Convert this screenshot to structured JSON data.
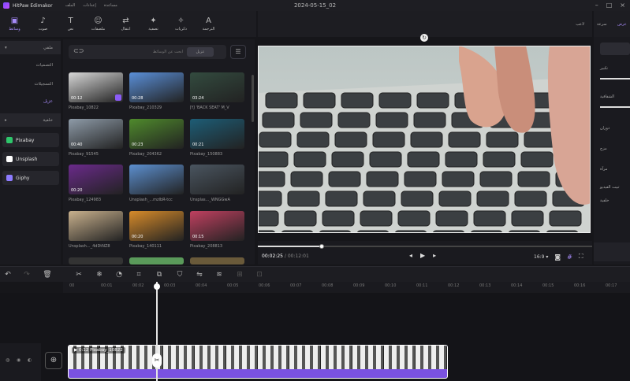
{
  "window": {
    "app_name": "HitPaw Edimakor",
    "project_title": "2024-05-15_02",
    "menu": [
      "الملف",
      "إعدادات",
      "مساعدة"
    ]
  },
  "toolbar": {
    "items": [
      {
        "label": "وسائط",
        "icon": "media-icon",
        "active": true
      },
      {
        "label": "صوت",
        "icon": "music-icon",
        "active": false
      },
      {
        "label": "نص",
        "icon": "text-icon",
        "active": false
      },
      {
        "label": "ملصقات",
        "icon": "sticker-icon",
        "active": false
      },
      {
        "label": "انتقال",
        "icon": "transition-icon",
        "active": false
      },
      {
        "label": "تصفية",
        "icon": "filter-icon",
        "active": false
      },
      {
        "label": "ذكريات",
        "icon": "effects-icon",
        "active": false
      },
      {
        "label": "الترجمة",
        "icon": "ai-subtitle-icon",
        "active": false
      }
    ]
  },
  "sidebar": {
    "rows": [
      {
        "label": "ملفي",
        "chevron": "▾"
      },
      {
        "label": "التصميات",
        "chevron": ""
      },
      {
        "label": "التسجيلات",
        "chevron": ""
      },
      {
        "label": "عزيل",
        "chevron": "",
        "highlight": true
      },
      {
        "label": "خلفية",
        "chevron": "▸"
      }
    ],
    "sources": [
      {
        "label": "Pixabay",
        "color": "#2ec66b"
      },
      {
        "label": "Unsplash",
        "color": "#ffffff"
      },
      {
        "label": "Giphy",
        "color": "#8d7bff"
      }
    ]
  },
  "media": {
    "search_button": "عزيل",
    "search_placeholder": "ابحث عن الوسائط",
    "thumbs": [
      {
        "label": "Pixabay_10822",
        "duration": "00:12",
        "bg": "#d7d7d7",
        "fav": true
      },
      {
        "label": "Pixabay_210329",
        "duration": "00:28",
        "bg": "#5a8fd8"
      },
      {
        "label": "JYJ 'BACK SEAT' M_V",
        "duration": "03:24",
        "bg": "#334b3f"
      },
      {
        "label": "Pixabay_91545",
        "duration": "00:40",
        "bg": "#8e9ba8"
      },
      {
        "label": "Pixabay_204362",
        "duration": "00:23",
        "bg": "#4f8a2c"
      },
      {
        "label": "Pixabay_150883",
        "duration": "00:21",
        "bg": "#1d5d76"
      },
      {
        "label": "Pixabay_124983",
        "duration": "00:20",
        "bg": "#6a2a8a"
      },
      {
        "label": "Unsplash_...mzlbR-tcc",
        "duration": "",
        "bg": "#5c8fcf"
      },
      {
        "label": "Unsplas..._WNGGwA",
        "duration": "",
        "bg": "#4a5560"
      },
      {
        "label": "Unsplash..._4dDtNZ8",
        "duration": "",
        "bg": "#c9b18d"
      },
      {
        "label": "Pixabay_140111",
        "duration": "00:20",
        "bg": "#d78b2a"
      },
      {
        "label": "Pixabay_208813",
        "duration": "00:15",
        "bg": "#c04060"
      }
    ]
  },
  "preview": {
    "header_label": "لاعب",
    "time_current": "00:02:25",
    "time_total": "00:12:01",
    "aspect": "16:9",
    "progress": 0.19
  },
  "right_panel": {
    "tabs": [
      "عرض",
      "سرعة"
    ],
    "labels": [
      "تكبير",
      "الشفافية",
      "دوران",
      "مزج",
      "مرآة",
      "ثبيت الفيديو",
      "خلفية"
    ]
  },
  "timeline": {
    "ticks": [
      "00",
      "00:01",
      "00:02",
      "00:03",
      "00:04",
      "00:05",
      "00:06",
      "00:07",
      "00:08",
      "00:09",
      "00:10",
      "00:11",
      "00:12",
      "00:13",
      "00:14",
      "00:15",
      "00:16",
      "00:17"
    ],
    "clip_label": "0:12 Pixabay_10822",
    "playhead_position": "00:02"
  }
}
